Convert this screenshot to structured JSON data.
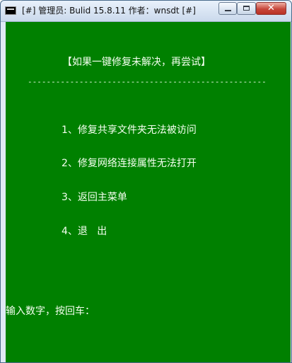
{
  "window": {
    "title": "[#] 管理员:  Bulid 15.8.11    作者：wnsdt [#]",
    "controls": {
      "minimize_icon": "minimize-icon",
      "maximize_icon": "maximize-icon",
      "close_icon": "close-icon",
      "close_symbol": "✕"
    }
  },
  "console": {
    "heading": "【如果一键修复未解决，再尝试】",
    "divider": "---------------------------------------------------",
    "menu": [
      "1、修复共享文件夹无法被访问",
      "2、修复网络连接属性无法打开",
      "3、返回主菜单",
      "4、退   出"
    ],
    "prompt": "输入数字，按回车："
  },
  "colors": {
    "console_background": "#008000",
    "console_text": "#f5fff0",
    "titlebar": "#dfe9f5",
    "close_button": "#c7463a"
  }
}
